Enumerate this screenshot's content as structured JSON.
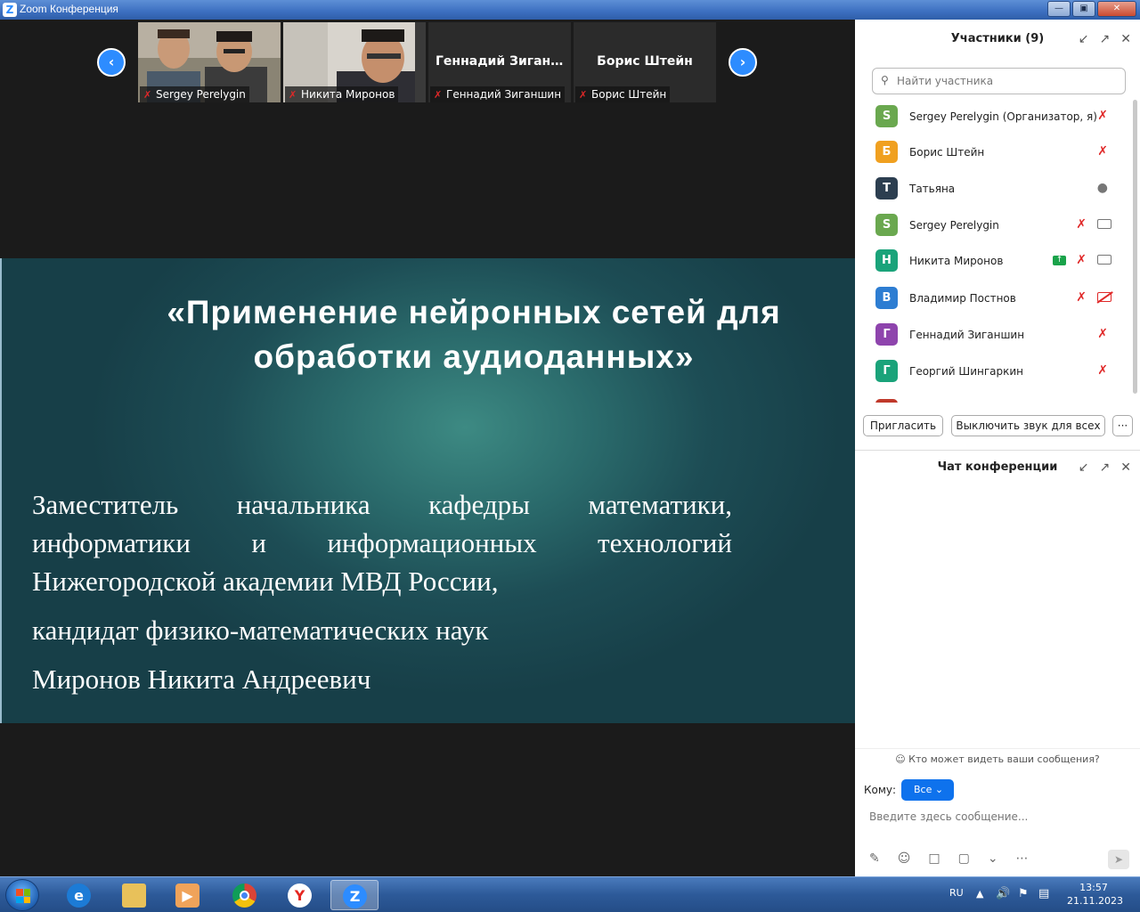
{
  "window": {
    "title": "Zoom Конференция"
  },
  "video_strip": {
    "tiles": [
      {
        "name": "Sergey Perelygin",
        "muted": true,
        "has_video": true
      },
      {
        "name": "Никита Миронов",
        "muted": true,
        "has_video": true
      },
      {
        "name": "Геннадий Зиганшин",
        "display_name": "Геннадий  Зиган...",
        "muted": true,
        "has_video": false
      },
      {
        "name": "Борис Штейн",
        "display_name": "Борис Штейн",
        "muted": true,
        "has_video": false
      }
    ]
  },
  "slide": {
    "title": "«Применение нейронных сетей для обработки аудиоданных»",
    "line1": "Заместитель начальника кафедры математики,",
    "line2": "информатики и информационных технологий",
    "line3": "Нижегородской академии МВД России,",
    "line4": "кандидат физико-математических наук",
    "line5": "Миронов Никита Андреевич"
  },
  "participants": {
    "header": "Участники (9)",
    "search_placeholder": "Найти участника",
    "list": [
      {
        "initial": "S",
        "name": "Sergey Perelygin (Организатор, я)",
        "color": "#6aa84f",
        "mic": "muted",
        "cam": "none"
      },
      {
        "initial": "Б",
        "name": "Борис Штейн",
        "color": "#f0a020",
        "mic": "muted",
        "cam": "none"
      },
      {
        "initial": "Т",
        "name": "Татьяна",
        "color": "#2c3e50",
        "mic": "on",
        "cam": "none"
      },
      {
        "initial": "S",
        "name": "Sergey Perelygin",
        "color": "#6aa84f",
        "mic": "muted",
        "cam": "on"
      },
      {
        "initial": "Н",
        "name": "Никита Миронов",
        "color": "#1aa37a",
        "mic": "muted",
        "cam": "on",
        "sharing": true
      },
      {
        "initial": "В",
        "name": "Владимир Постнов",
        "color": "#2d7dd2",
        "mic": "muted",
        "cam": "off"
      },
      {
        "initial": "Г",
        "name": "Геннадий Зиганшин",
        "color": "#8e44ad",
        "mic": "muted",
        "cam": "none"
      },
      {
        "initial": "Г",
        "name": "Георгий Шингаркин",
        "color": "#1aa37a",
        "mic": "muted",
        "cam": "none"
      }
    ],
    "invite_label": "Пригласить",
    "mute_all_label": "Выключить звук для всех",
    "more_label": "···"
  },
  "chat": {
    "header": "Чат конференции",
    "visibility_text": "Кто может видеть ваши сообщения?",
    "to_label": "Кому:",
    "to_value": "Все",
    "input_placeholder": "Введите здесь сообщение..."
  },
  "taskbar": {
    "lang": "RU",
    "time": "13:57",
    "date": "21.11.2023"
  }
}
